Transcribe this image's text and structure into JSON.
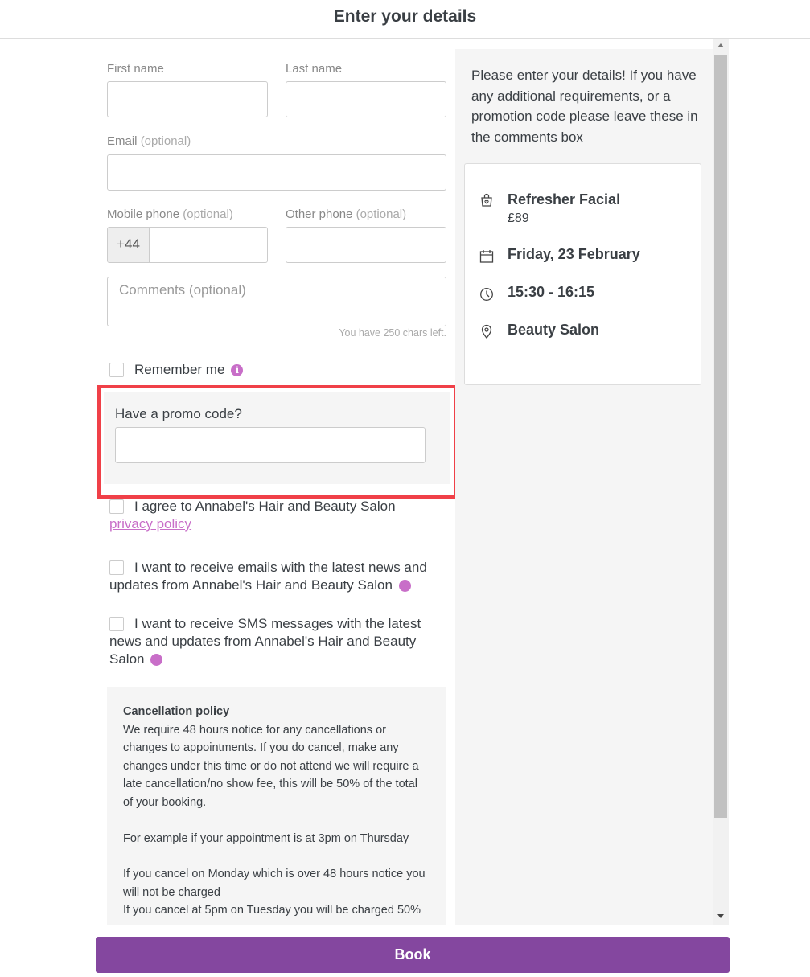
{
  "header": {
    "title": "Enter your details"
  },
  "form": {
    "first_name_label": "First name",
    "last_name_label": "Last name",
    "email_label": "Email",
    "optional": "(optional)",
    "mobile_label": "Mobile phone",
    "other_phone_label": "Other phone",
    "phone_prefix": "+44",
    "comments_placeholder": "Comments (optional)",
    "chars_left": "You have 250 chars left.",
    "remember_me": "Remember me",
    "promo_label": "Have a promo code?",
    "privacy_text": "I agree to Annabel's Hair and Beauty Salon",
    "privacy_link": "privacy policy",
    "emails_text": "I want to receive emails with the latest news and updates from Annabel's Hair and Beauty Salon",
    "sms_text": "I want to receive SMS messages with the latest news and updates from Annabel's Hair and Beauty Salon"
  },
  "cancellation": {
    "title": "Cancellation policy",
    "p1": "We require 48 hours notice for any cancellations or changes to appointments. If you do cancel, make any changes under this time or do not attend we will require a late cancellation/no show fee, this will be 50% of the total of your booking.",
    "p2": "For example if your appointment is at 3pm on Thursday",
    "p3": "If you cancel on Monday which is over 48 hours notice you will not be charged",
    "p4": "If you cancel at 5pm on Tuesday you will be charged 50%"
  },
  "summary": {
    "intro": "Please enter your details! If you have any additional requirements, or a promotion code please leave these in the comments box",
    "service": "Refresher Facial",
    "price": "£89",
    "date": "Friday, 23 February",
    "time": "15:30 - 16:15",
    "location": "Beauty Salon"
  },
  "book_label": "Book",
  "colors": {
    "accent": "#84479f",
    "link": "#c86ec8",
    "highlight": "#f04048"
  }
}
